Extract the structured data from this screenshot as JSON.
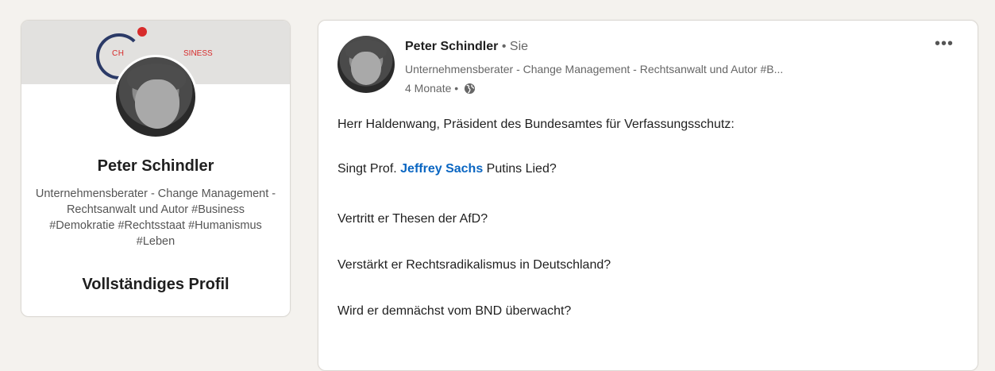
{
  "profile": {
    "banner_logo_left": "CH",
    "banner_logo_right": "SINESS",
    "name": "Peter Schindler",
    "headline": "Unternehmensberater - Change Management - Rechtsanwalt und Autor #Business #Demokratie #Rechtsstaat #Humanismus #Leben",
    "full_profile_link": "Vollständiges Profil"
  },
  "post": {
    "author_name": "Peter Schindler",
    "separator": "•",
    "relation": "Sie",
    "author_headline": "Unternehmensberater - Change Management - Rechtsanwalt und Autor #B...",
    "time": "4 Monate",
    "meta_separator": "•",
    "more_icon_glyph": "•••",
    "lines": {
      "l1": "Herr Haldenwang, Präsident des Bundesamtes für Verfassungsschutz:",
      "l2_prefix": "Singt Prof.",
      "l2_mention": "Jeffrey Sachs",
      "l2_suffix": "Putins Lied?",
      "l3": "Vertritt er Thesen der AfD?",
      "l4": "Verstärkt er Rechtsradikalismus in Deutschland?",
      "l5": "Wird er demnächst vom BND überwacht?"
    }
  },
  "colors": {
    "background": "#f4f2ee",
    "link_blue": "#0a66c2",
    "logo_red": "#d72b2b",
    "logo_navy": "#2b3a67"
  }
}
